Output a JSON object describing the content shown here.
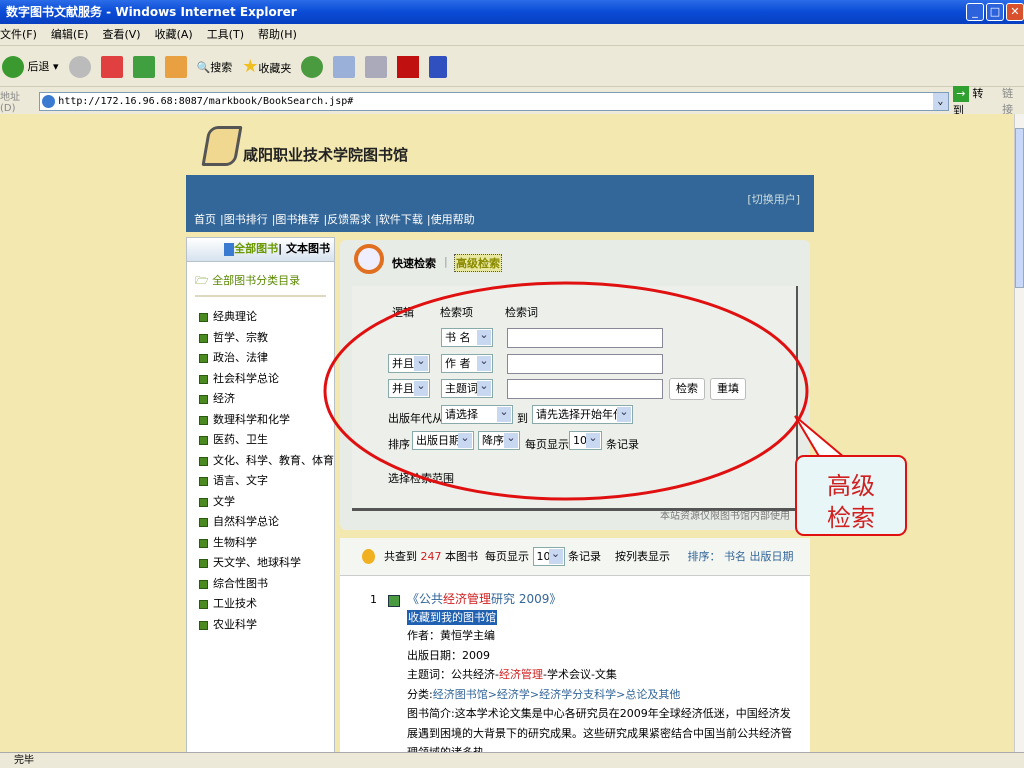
{
  "window": {
    "title": "数字图书文献服务 - Windows Internet Explorer",
    "status": "完毕"
  },
  "menu": [
    "文件(F)",
    "编辑(E)",
    "查看(V)",
    "收藏(A)",
    "工具(T)",
    "帮助(H)"
  ],
  "toolbar": {
    "back": "后退",
    "search": "搜索",
    "favorites": "收藏夹"
  },
  "address": {
    "label": "地址(D)",
    "url": "http://172.16.96.68:8087/markbook/BookSearch.jsp#",
    "go": "转到",
    "links": "链接"
  },
  "site": {
    "name": "咸阳职业技术学院图书馆",
    "switch_user": "[切换用户]",
    "nav": [
      "首页",
      "|图书排行",
      "|图书推荐",
      "|反馈需求",
      "|软件下载",
      "|使用帮助"
    ]
  },
  "left": {
    "tab_all": "全部图书",
    "tab_text": "| 文本图书",
    "catalog": "全部图书分类目录",
    "categories": [
      "经典理论",
      "哲学、宗教",
      "政治、法律",
      "社会科学总论",
      "经济",
      "数理科学和化学",
      "医药、卫生",
      "文化、科学、教育、体育",
      "语言、文字",
      "文学",
      "自然科学总论",
      "生物科学",
      "天文学、地球科学",
      "综合性图书",
      "工业技术",
      "农业科学"
    ]
  },
  "search": {
    "quick": "快速检索",
    "sep": "|",
    "advanced": "高级检索",
    "col_logic": "逻辑",
    "col_field": "检索项",
    "col_term": "检索词",
    "rows": [
      {
        "logic": "",
        "field": "书 名"
      },
      {
        "logic": "并且",
        "field": "作 者"
      },
      {
        "logic": "并且",
        "field": "主题词"
      }
    ],
    "search_btn": "检索",
    "reset_btn": "重填",
    "year_from_label": "出版年代从",
    "year_from": "请选择",
    "to": "到",
    "year_to": "请先选择开始年代",
    "sort_label": "排序",
    "sort_field": "出版日期",
    "sort_order": "降序",
    "per_page_label": "每页显示",
    "per_page": "10",
    "records": "条记录",
    "scope": "选择检索范围",
    "notice": "本站资源仅限图书馆内部使用"
  },
  "results": {
    "found_prefix": "共查到",
    "count": "247",
    "found_suffix": "本图书",
    "per_page_label": "每页显示",
    "per_page": "10",
    "records": "条记录",
    "list_view": "按列表显示",
    "sort_label": "排序：",
    "sort_name": "书名",
    "sort_date": "出版日期",
    "item": {
      "index": "1",
      "title_a": "《公共",
      "title_hl": "经济管理",
      "title_b": "研究 2009》",
      "collect": "收藏到我的图书馆",
      "author": "作者：黄恒学主编",
      "date": "出版日期：2009",
      "subject_a": "主题词：公共经济-",
      "subject_hl": "经济管理",
      "subject_b": "-学术会议-文集",
      "category_label": "分类:",
      "category": "经济图书馆>经济学>经济学分支科学>总论及其他",
      "summary": "图书简介:这本学术论文集是中心各研究员在2009年全球经济低迷，中国经济发展遇到困境的大背景下的研究成果。这些研究成果紧密结合中国当前公共经济管理领域的诸多热"
    }
  },
  "callout": {
    "line1": "高级",
    "line2": "检索"
  }
}
